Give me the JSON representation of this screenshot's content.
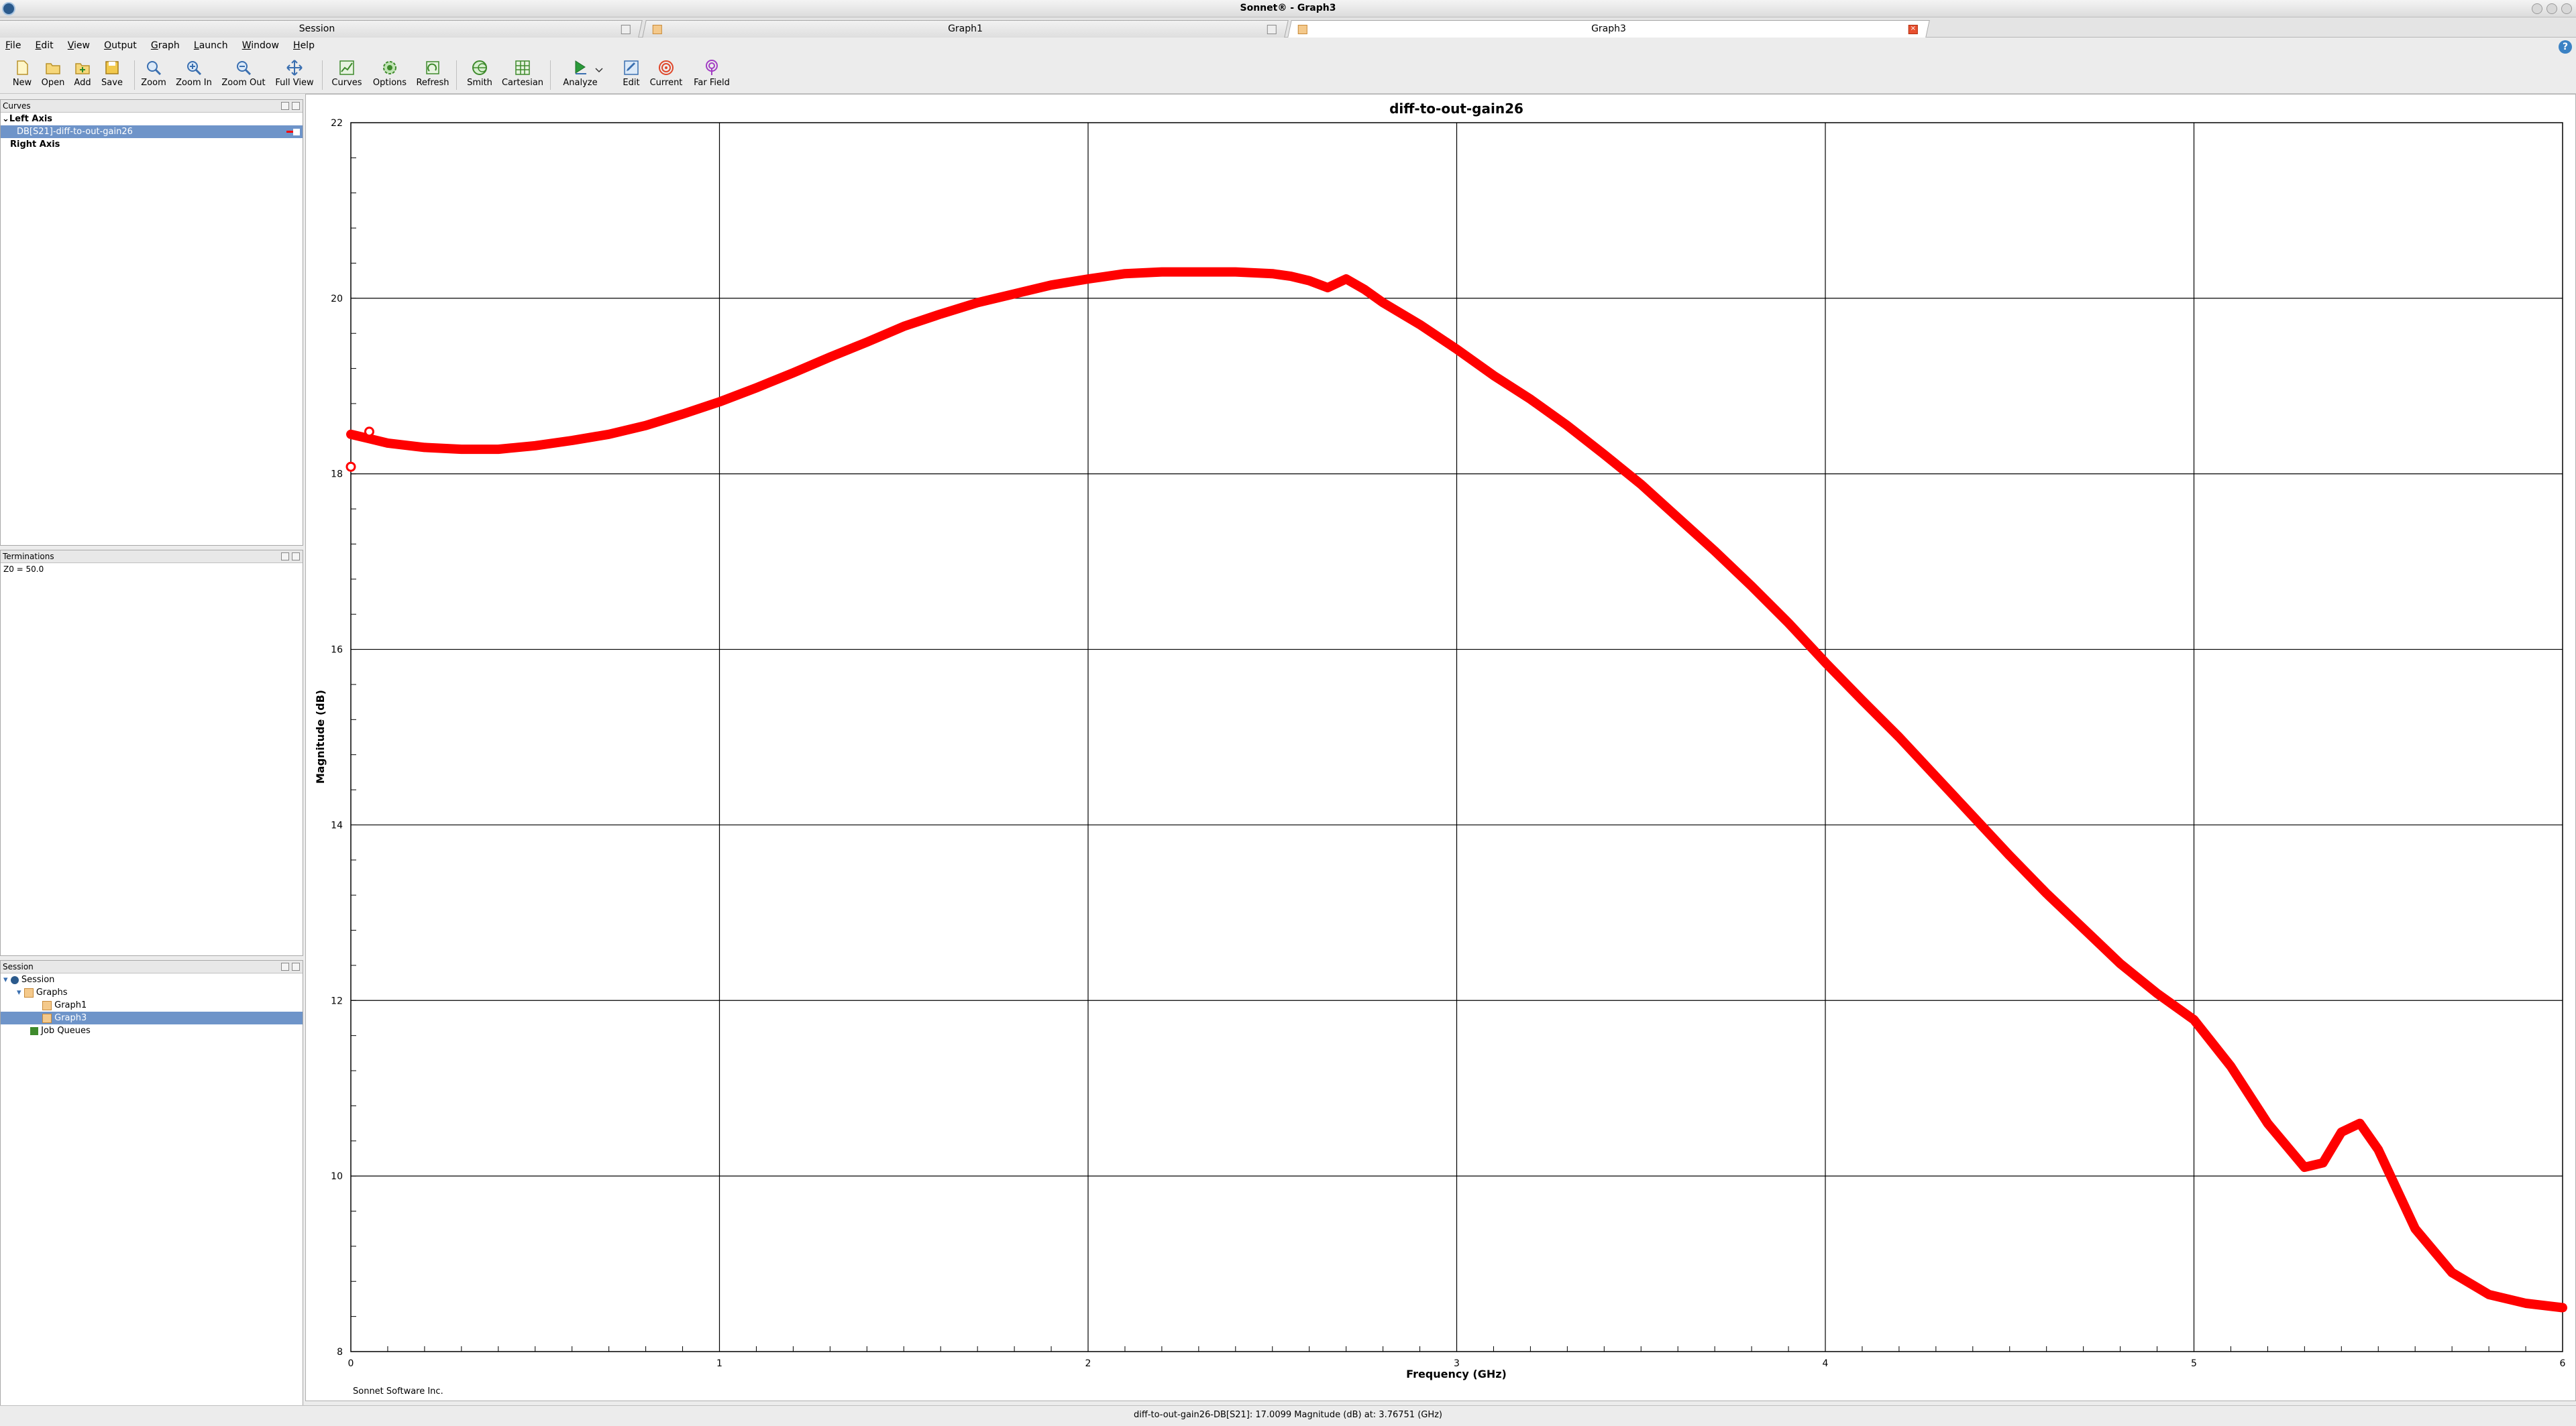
{
  "window": {
    "title": "Sonnet® - Graph3"
  },
  "tabs": [
    {
      "label": "Session"
    },
    {
      "label": "Graph1"
    },
    {
      "label": "Graph3",
      "active": true
    }
  ],
  "menu": [
    "File",
    "Edit",
    "View",
    "Output",
    "Graph",
    "Launch",
    "Window",
    "Help"
  ],
  "toolbar": {
    "new": "New",
    "open": "Open",
    "add": "Add",
    "save": "Save",
    "zoom": "Zoom",
    "zoom_in": "Zoom In",
    "zoom_out": "Zoom Out",
    "full_view": "Full View",
    "curves": "Curves",
    "options": "Options",
    "refresh": "Refresh",
    "smith": "Smith",
    "cartesian": "Cartesian",
    "analyze": "Analyze",
    "edit": "Edit",
    "current": "Current",
    "far_field": "Far Field"
  },
  "curves_panel": {
    "title": "Curves",
    "left_axis": "Left Axis",
    "curve": "DB[S21]-diff-to-out-gain26",
    "right_axis": "Right Axis"
  },
  "terminations_panel": {
    "title": "Terminations",
    "text": "Z0 = 50.0"
  },
  "session_panel": {
    "title": "Session",
    "session": "Session",
    "graphs": "Graphs",
    "graph1": "Graph1",
    "graph3": "Graph3",
    "job_queues": "Job Queues"
  },
  "footer_text": "Sonnet Software Inc.",
  "status": "diff-to-out-gain26-DB[S21]: 17.0099 Magnitude (dB) at: 3.76751 (GHz)",
  "colors": {
    "curve": "#ff0000",
    "selection": "#6e94c9",
    "grid": "#000000"
  },
  "chart_data": {
    "type": "line",
    "title": "diff-to-out-gain26",
    "xlabel": "Frequency (GHz)",
    "ylabel": "Magnitude (dB)",
    "xlim": [
      0,
      6
    ],
    "ylim": [
      8,
      22
    ],
    "xticks": [
      0,
      1,
      2,
      3,
      4,
      5,
      6
    ],
    "yticks": [
      8,
      10,
      12,
      14,
      16,
      18,
      20,
      22
    ],
    "grid": true,
    "series": [
      {
        "name": "DB[S21]-diff-to-out-gain26",
        "x": [
          0,
          0.05,
          0.1,
          0.2,
          0.3,
          0.4,
          0.5,
          0.6,
          0.7,
          0.8,
          0.9,
          1.0,
          1.1,
          1.2,
          1.3,
          1.4,
          1.5,
          1.6,
          1.7,
          1.8,
          1.9,
          2.0,
          2.1,
          2.2,
          2.3,
          2.4,
          2.5,
          2.55,
          2.6,
          2.65,
          2.7,
          2.75,
          2.8,
          2.9,
          3.0,
          3.1,
          3.2,
          3.3,
          3.4,
          3.5,
          3.6,
          3.7,
          3.8,
          3.9,
          4.0,
          4.1,
          4.2,
          4.3,
          4.4,
          4.5,
          4.6,
          4.7,
          4.8,
          4.9,
          5.0,
          5.1,
          5.2,
          5.3,
          5.35,
          5.4,
          5.45,
          5.5,
          5.6,
          5.7,
          5.8,
          5.9,
          6.0
        ],
        "values": [
          18.45,
          18.4,
          18.35,
          18.3,
          18.28,
          18.28,
          18.32,
          18.38,
          18.45,
          18.55,
          18.68,
          18.82,
          18.98,
          19.15,
          19.33,
          19.5,
          19.68,
          19.82,
          19.95,
          20.05,
          20.15,
          20.22,
          20.28,
          20.3,
          20.3,
          20.3,
          20.28,
          20.25,
          20.2,
          20.12,
          20.22,
          20.1,
          19.95,
          19.7,
          19.42,
          19.12,
          18.85,
          18.55,
          18.22,
          17.88,
          17.5,
          17.12,
          16.72,
          16.3,
          15.85,
          15.42,
          15.0,
          14.55,
          14.1,
          13.65,
          13.22,
          12.82,
          12.42,
          12.08,
          11.78,
          11.25,
          10.6,
          10.1,
          10.15,
          10.5,
          10.6,
          10.3,
          9.4,
          8.9,
          8.65,
          8.55,
          8.5
        ]
      }
    ]
  }
}
